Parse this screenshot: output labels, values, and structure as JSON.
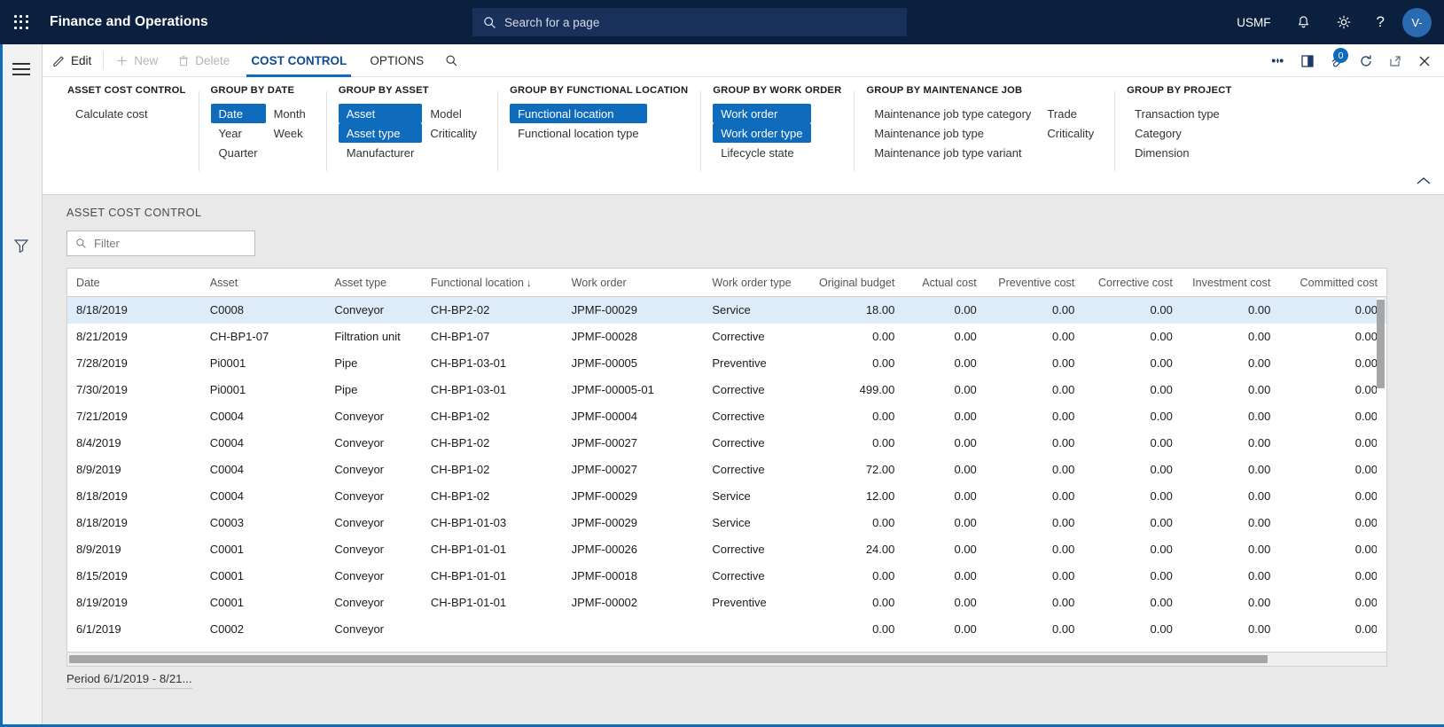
{
  "header": {
    "app_title": "Finance and Operations",
    "waffle_icon": "app-launcher-icon",
    "search": {
      "placeholder": "Search for a page",
      "icon": "search-icon"
    },
    "company": "USMF",
    "notifications_icon": "bell-icon",
    "settings_icon": "gear-icon",
    "help_icon": "question-mark-icon",
    "avatar_initials": "V-"
  },
  "rail": {
    "menu_icon": "hamburger-menu-icon",
    "filter_icon": "funnel-filter-icon"
  },
  "commandbar": {
    "edit_label": "Edit",
    "new_label": "New",
    "delete_label": "Delete",
    "tabs": [
      {
        "label": "COST CONTROL",
        "active": true
      },
      {
        "label": "OPTIONS",
        "active": false
      }
    ],
    "search_icon": "search-icon",
    "right_icons": [
      {
        "name": "attach-link-icon",
        "glyph": "❖"
      },
      {
        "name": "open-in-new-window-icon",
        "glyph": "◧"
      },
      {
        "name": "attachments-icon",
        "glyph": "📎",
        "badge": "0"
      },
      {
        "name": "refresh-icon",
        "glyph": "↻"
      },
      {
        "name": "popout-icon",
        "glyph": "↗"
      },
      {
        "name": "close-icon",
        "glyph": "✕"
      }
    ]
  },
  "ribbon": {
    "collapse_icon": "chevron-up-icon",
    "groups": [
      {
        "title": "ASSET COST CONTROL",
        "columns": [
          {
            "items": [
              {
                "label": "Calculate cost",
                "selected": false
              }
            ]
          }
        ]
      },
      {
        "title": "GROUP BY DATE",
        "columns": [
          {
            "items": [
              {
                "label": "Date",
                "selected": true
              },
              {
                "label": "Year",
                "selected": false
              },
              {
                "label": "Quarter",
                "selected": false
              }
            ]
          },
          {
            "items": [
              {
                "label": "Month",
                "selected": false
              },
              {
                "label": "Week",
                "selected": false
              }
            ]
          }
        ]
      },
      {
        "title": "GROUP BY ASSET",
        "columns": [
          {
            "items": [
              {
                "label": "Asset",
                "selected": true
              },
              {
                "label": "Asset type",
                "selected": true
              },
              {
                "label": "Manufacturer",
                "selected": false
              }
            ]
          },
          {
            "items": [
              {
                "label": "Model",
                "selected": false
              },
              {
                "label": "Criticality",
                "selected": false
              }
            ]
          }
        ]
      },
      {
        "title": "GROUP BY FUNCTIONAL LOCATION",
        "columns": [
          {
            "items": [
              {
                "label": "Functional location",
                "selected": true
              },
              {
                "label": "Functional location type",
                "selected": false
              }
            ]
          }
        ]
      },
      {
        "title": "GROUP BY WORK ORDER",
        "columns": [
          {
            "items": [
              {
                "label": "Work order",
                "selected": true
              },
              {
                "label": "Work order type",
                "selected": true
              },
              {
                "label": "Lifecycle state",
                "selected": false
              }
            ]
          }
        ]
      },
      {
        "title": "GROUP BY MAINTENANCE JOB",
        "columns": [
          {
            "items": [
              {
                "label": "Maintenance job type category",
                "selected": false
              },
              {
                "label": "Maintenance job type",
                "selected": false
              },
              {
                "label": "Maintenance job type variant",
                "selected": false
              }
            ]
          },
          {
            "items": [
              {
                "label": "Trade",
                "selected": false
              },
              {
                "label": "Criticality",
                "selected": false
              }
            ]
          }
        ]
      },
      {
        "title": "GROUP BY PROJECT",
        "columns": [
          {
            "items": [
              {
                "label": "Transaction type",
                "selected": false
              },
              {
                "label": "Category",
                "selected": false
              },
              {
                "label": "Dimension",
                "selected": false
              }
            ]
          }
        ]
      }
    ]
  },
  "main": {
    "section_title": "ASSET COST CONTROL",
    "filter": {
      "placeholder": "Filter",
      "value": "",
      "icon": "search-icon"
    },
    "period_label": "Period 6/1/2019 - 8/21...",
    "grid": {
      "sorted_column": "Functional location",
      "sort_arrow": "↓",
      "columns": [
        {
          "label": "Date",
          "align": "left"
        },
        {
          "label": "Asset",
          "align": "left"
        },
        {
          "label": "Asset type",
          "align": "left"
        },
        {
          "label": "Functional location",
          "align": "left",
          "sorted": true
        },
        {
          "label": "Work order",
          "align": "left"
        },
        {
          "label": "Work order type",
          "align": "left"
        },
        {
          "label": "Original budget",
          "align": "right"
        },
        {
          "label": "Actual cost",
          "align": "right"
        },
        {
          "label": "Preventive cost",
          "align": "right"
        },
        {
          "label": "Corrective cost",
          "align": "right"
        },
        {
          "label": "Investment cost",
          "align": "right"
        },
        {
          "label": "Committed cost",
          "align": "right"
        }
      ],
      "rows": [
        {
          "selected": true,
          "cells": [
            "8/18/2019",
            "C0008",
            "Conveyor",
            "CH-BP2-02",
            "JPMF-00029",
            "Service",
            "18.00",
            "0.00",
            "0.00",
            "0.00",
            "0.00",
            "0.00"
          ]
        },
        {
          "selected": false,
          "cells": [
            "8/21/2019",
            "CH-BP1-07",
            "Filtration unit",
            "CH-BP1-07",
            "JPMF-00028",
            "Corrective",
            "0.00",
            "0.00",
            "0.00",
            "0.00",
            "0.00",
            "0.00"
          ]
        },
        {
          "selected": false,
          "cells": [
            "7/28/2019",
            "Pi0001",
            "Pipe",
            "CH-BP1-03-01",
            "JPMF-00005",
            "Preventive",
            "0.00",
            "0.00",
            "0.00",
            "0.00",
            "0.00",
            "0.00"
          ]
        },
        {
          "selected": false,
          "cells": [
            "7/30/2019",
            "Pi0001",
            "Pipe",
            "CH-BP1-03-01",
            "JPMF-00005-01",
            "Corrective",
            "499.00",
            "0.00",
            "0.00",
            "0.00",
            "0.00",
            "0.00"
          ]
        },
        {
          "selected": false,
          "cells": [
            "7/21/2019",
            "C0004",
            "Conveyor",
            "CH-BP1-02",
            "JPMF-00004",
            "Corrective",
            "0.00",
            "0.00",
            "0.00",
            "0.00",
            "0.00",
            "0.00"
          ]
        },
        {
          "selected": false,
          "cells": [
            "8/4/2019",
            "C0004",
            "Conveyor",
            "CH-BP1-02",
            "JPMF-00027",
            "Corrective",
            "0.00",
            "0.00",
            "0.00",
            "0.00",
            "0.00",
            "0.00"
          ]
        },
        {
          "selected": false,
          "cells": [
            "8/9/2019",
            "C0004",
            "Conveyor",
            "CH-BP1-02",
            "JPMF-00027",
            "Corrective",
            "72.00",
            "0.00",
            "0.00",
            "0.00",
            "0.00",
            "0.00"
          ]
        },
        {
          "selected": false,
          "cells": [
            "8/18/2019",
            "C0004",
            "Conveyor",
            "CH-BP1-02",
            "JPMF-00029",
            "Service",
            "12.00",
            "0.00",
            "0.00",
            "0.00",
            "0.00",
            "0.00"
          ]
        },
        {
          "selected": false,
          "cells": [
            "8/18/2019",
            "C0003",
            "Conveyor",
            "CH-BP1-01-03",
            "JPMF-00029",
            "Service",
            "0.00",
            "0.00",
            "0.00",
            "0.00",
            "0.00",
            "0.00"
          ]
        },
        {
          "selected": false,
          "cells": [
            "8/9/2019",
            "C0001",
            "Conveyor",
            "CH-BP1-01-01",
            "JPMF-00026",
            "Corrective",
            "24.00",
            "0.00",
            "0.00",
            "0.00",
            "0.00",
            "0.00"
          ]
        },
        {
          "selected": false,
          "cells": [
            "8/15/2019",
            "C0001",
            "Conveyor",
            "CH-BP1-01-01",
            "JPMF-00018",
            "Corrective",
            "0.00",
            "0.00",
            "0.00",
            "0.00",
            "0.00",
            "0.00"
          ]
        },
        {
          "selected": false,
          "cells": [
            "8/19/2019",
            "C0001",
            "Conveyor",
            "CH-BP1-01-01",
            "JPMF-00002",
            "Preventive",
            "0.00",
            "0.00",
            "0.00",
            "0.00",
            "0.00",
            "0.00"
          ]
        },
        {
          "selected": false,
          "cells": [
            "6/1/2019",
            "C0002",
            "Conveyor",
            "",
            "",
            "",
            "0.00",
            "0.00",
            "0.00",
            "0.00",
            "0.00",
            "0.00"
          ]
        }
      ]
    }
  },
  "colors": {
    "header_bg": "#0b1f3f",
    "accent": "#0f6cbd",
    "selection": "#deecf9",
    "content_bg": "#e9e9e9"
  }
}
